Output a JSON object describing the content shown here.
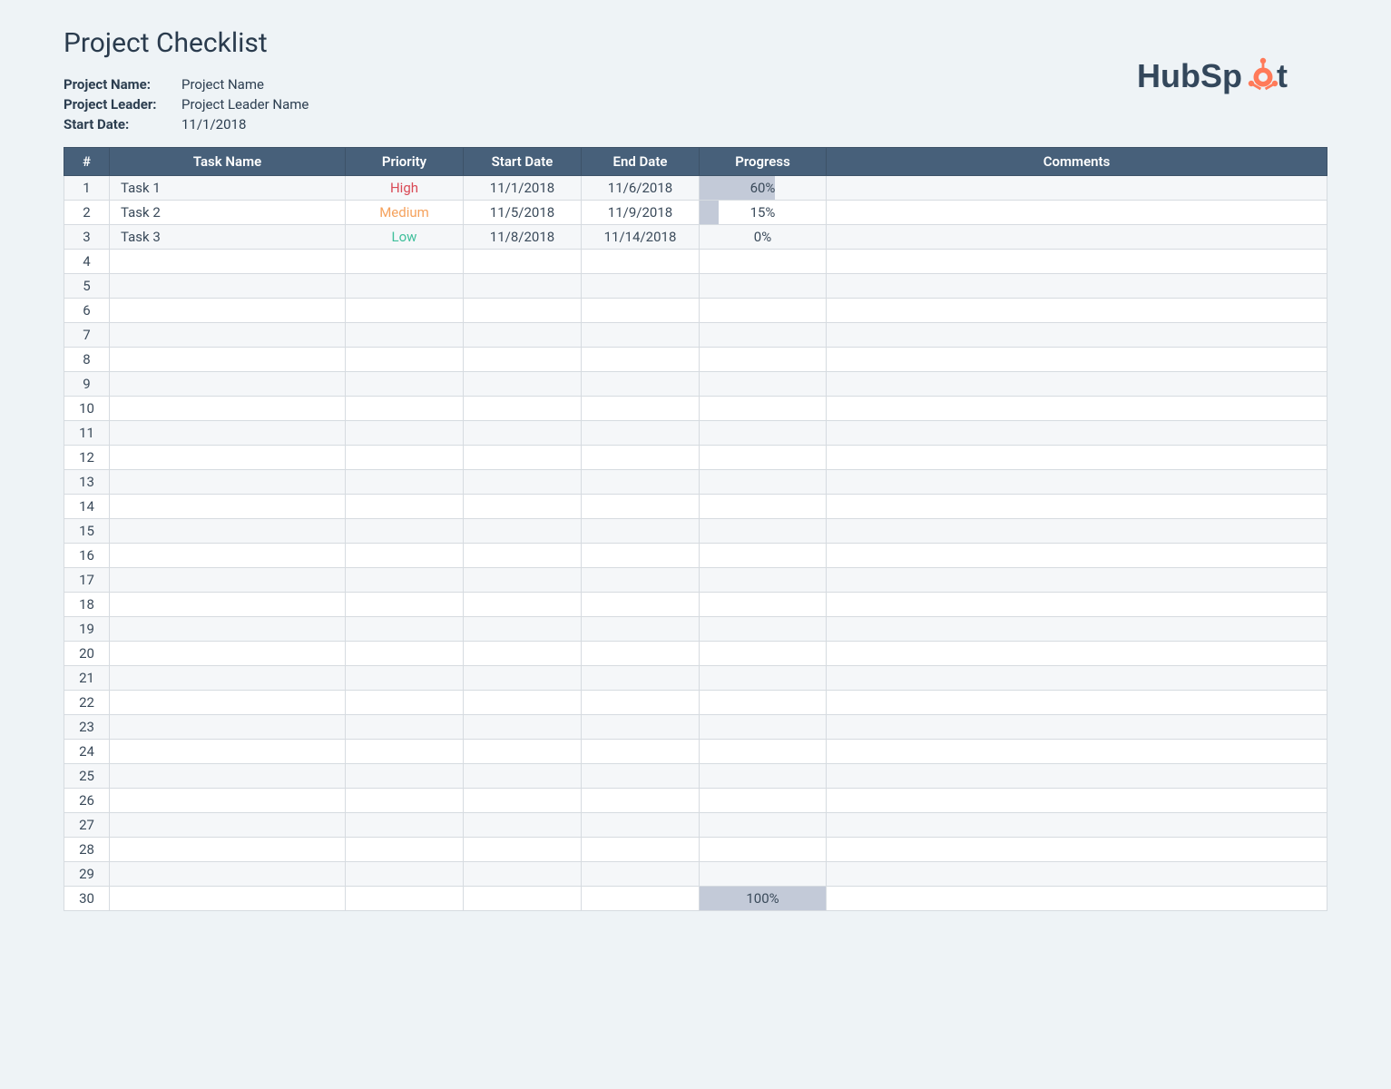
{
  "title": "Project Checklist",
  "meta": {
    "project_name_label": "Project Name:",
    "project_name_value": "Project Name",
    "project_leader_label": "Project Leader:",
    "project_leader_value": "Project Leader Name",
    "start_date_label": "Start Date:",
    "start_date_value": "11/1/2018"
  },
  "logo": {
    "brand_left": "HubSp",
    "brand_right": "t"
  },
  "columns": {
    "num": "#",
    "task": "Task Name",
    "priority": "Priority",
    "start": "Start Date",
    "end": "End Date",
    "progress": "Progress",
    "comments": "Comments"
  },
  "priority_colors": {
    "High": "prio-high",
    "Medium": "prio-medium",
    "Low": "prio-low"
  },
  "rows": [
    {
      "n": "1",
      "task": "Task 1",
      "priority": "High",
      "start": "11/1/2018",
      "end": "11/6/2018",
      "progress": 60,
      "progress_text": "60%",
      "comments": ""
    },
    {
      "n": "2",
      "task": "Task 2",
      "priority": "Medium",
      "start": "11/5/2018",
      "end": "11/9/2018",
      "progress": 15,
      "progress_text": "15%",
      "comments": ""
    },
    {
      "n": "3",
      "task": "Task 3",
      "priority": "Low",
      "start": "11/8/2018",
      "end": "11/14/2018",
      "progress": 0,
      "progress_text": "0%",
      "comments": ""
    },
    {
      "n": "4",
      "task": "",
      "priority": "",
      "start": "",
      "end": "",
      "progress": null,
      "progress_text": "",
      "comments": ""
    },
    {
      "n": "5",
      "task": "",
      "priority": "",
      "start": "",
      "end": "",
      "progress": null,
      "progress_text": "",
      "comments": ""
    },
    {
      "n": "6",
      "task": "",
      "priority": "",
      "start": "",
      "end": "",
      "progress": null,
      "progress_text": "",
      "comments": ""
    },
    {
      "n": "7",
      "task": "",
      "priority": "",
      "start": "",
      "end": "",
      "progress": null,
      "progress_text": "",
      "comments": ""
    },
    {
      "n": "8",
      "task": "",
      "priority": "",
      "start": "",
      "end": "",
      "progress": null,
      "progress_text": "",
      "comments": ""
    },
    {
      "n": "9",
      "task": "",
      "priority": "",
      "start": "",
      "end": "",
      "progress": null,
      "progress_text": "",
      "comments": ""
    },
    {
      "n": "10",
      "task": "",
      "priority": "",
      "start": "",
      "end": "",
      "progress": null,
      "progress_text": "",
      "comments": ""
    },
    {
      "n": "11",
      "task": "",
      "priority": "",
      "start": "",
      "end": "",
      "progress": null,
      "progress_text": "",
      "comments": ""
    },
    {
      "n": "12",
      "task": "",
      "priority": "",
      "start": "",
      "end": "",
      "progress": null,
      "progress_text": "",
      "comments": ""
    },
    {
      "n": "13",
      "task": "",
      "priority": "",
      "start": "",
      "end": "",
      "progress": null,
      "progress_text": "",
      "comments": ""
    },
    {
      "n": "14",
      "task": "",
      "priority": "",
      "start": "",
      "end": "",
      "progress": null,
      "progress_text": "",
      "comments": ""
    },
    {
      "n": "15",
      "task": "",
      "priority": "",
      "start": "",
      "end": "",
      "progress": null,
      "progress_text": "",
      "comments": ""
    },
    {
      "n": "16",
      "task": "",
      "priority": "",
      "start": "",
      "end": "",
      "progress": null,
      "progress_text": "",
      "comments": ""
    },
    {
      "n": "17",
      "task": "",
      "priority": "",
      "start": "",
      "end": "",
      "progress": null,
      "progress_text": "",
      "comments": ""
    },
    {
      "n": "18",
      "task": "",
      "priority": "",
      "start": "",
      "end": "",
      "progress": null,
      "progress_text": "",
      "comments": ""
    },
    {
      "n": "19",
      "task": "",
      "priority": "",
      "start": "",
      "end": "",
      "progress": null,
      "progress_text": "",
      "comments": ""
    },
    {
      "n": "20",
      "task": "",
      "priority": "",
      "start": "",
      "end": "",
      "progress": null,
      "progress_text": "",
      "comments": ""
    },
    {
      "n": "21",
      "task": "",
      "priority": "",
      "start": "",
      "end": "",
      "progress": null,
      "progress_text": "",
      "comments": ""
    },
    {
      "n": "22",
      "task": "",
      "priority": "",
      "start": "",
      "end": "",
      "progress": null,
      "progress_text": "",
      "comments": ""
    },
    {
      "n": "23",
      "task": "",
      "priority": "",
      "start": "",
      "end": "",
      "progress": null,
      "progress_text": "",
      "comments": ""
    },
    {
      "n": "24",
      "task": "",
      "priority": "",
      "start": "",
      "end": "",
      "progress": null,
      "progress_text": "",
      "comments": ""
    },
    {
      "n": "25",
      "task": "",
      "priority": "",
      "start": "",
      "end": "",
      "progress": null,
      "progress_text": "",
      "comments": ""
    },
    {
      "n": "26",
      "task": "",
      "priority": "",
      "start": "",
      "end": "",
      "progress": null,
      "progress_text": "",
      "comments": ""
    },
    {
      "n": "27",
      "task": "",
      "priority": "",
      "start": "",
      "end": "",
      "progress": null,
      "progress_text": "",
      "comments": ""
    },
    {
      "n": "28",
      "task": "",
      "priority": "",
      "start": "",
      "end": "",
      "progress": null,
      "progress_text": "",
      "comments": ""
    },
    {
      "n": "29",
      "task": "",
      "priority": "",
      "start": "",
      "end": "",
      "progress": null,
      "progress_text": "",
      "comments": ""
    },
    {
      "n": "30",
      "task": "",
      "priority": "",
      "start": "",
      "end": "",
      "progress": 100,
      "progress_text": "100%",
      "comments": ""
    }
  ]
}
